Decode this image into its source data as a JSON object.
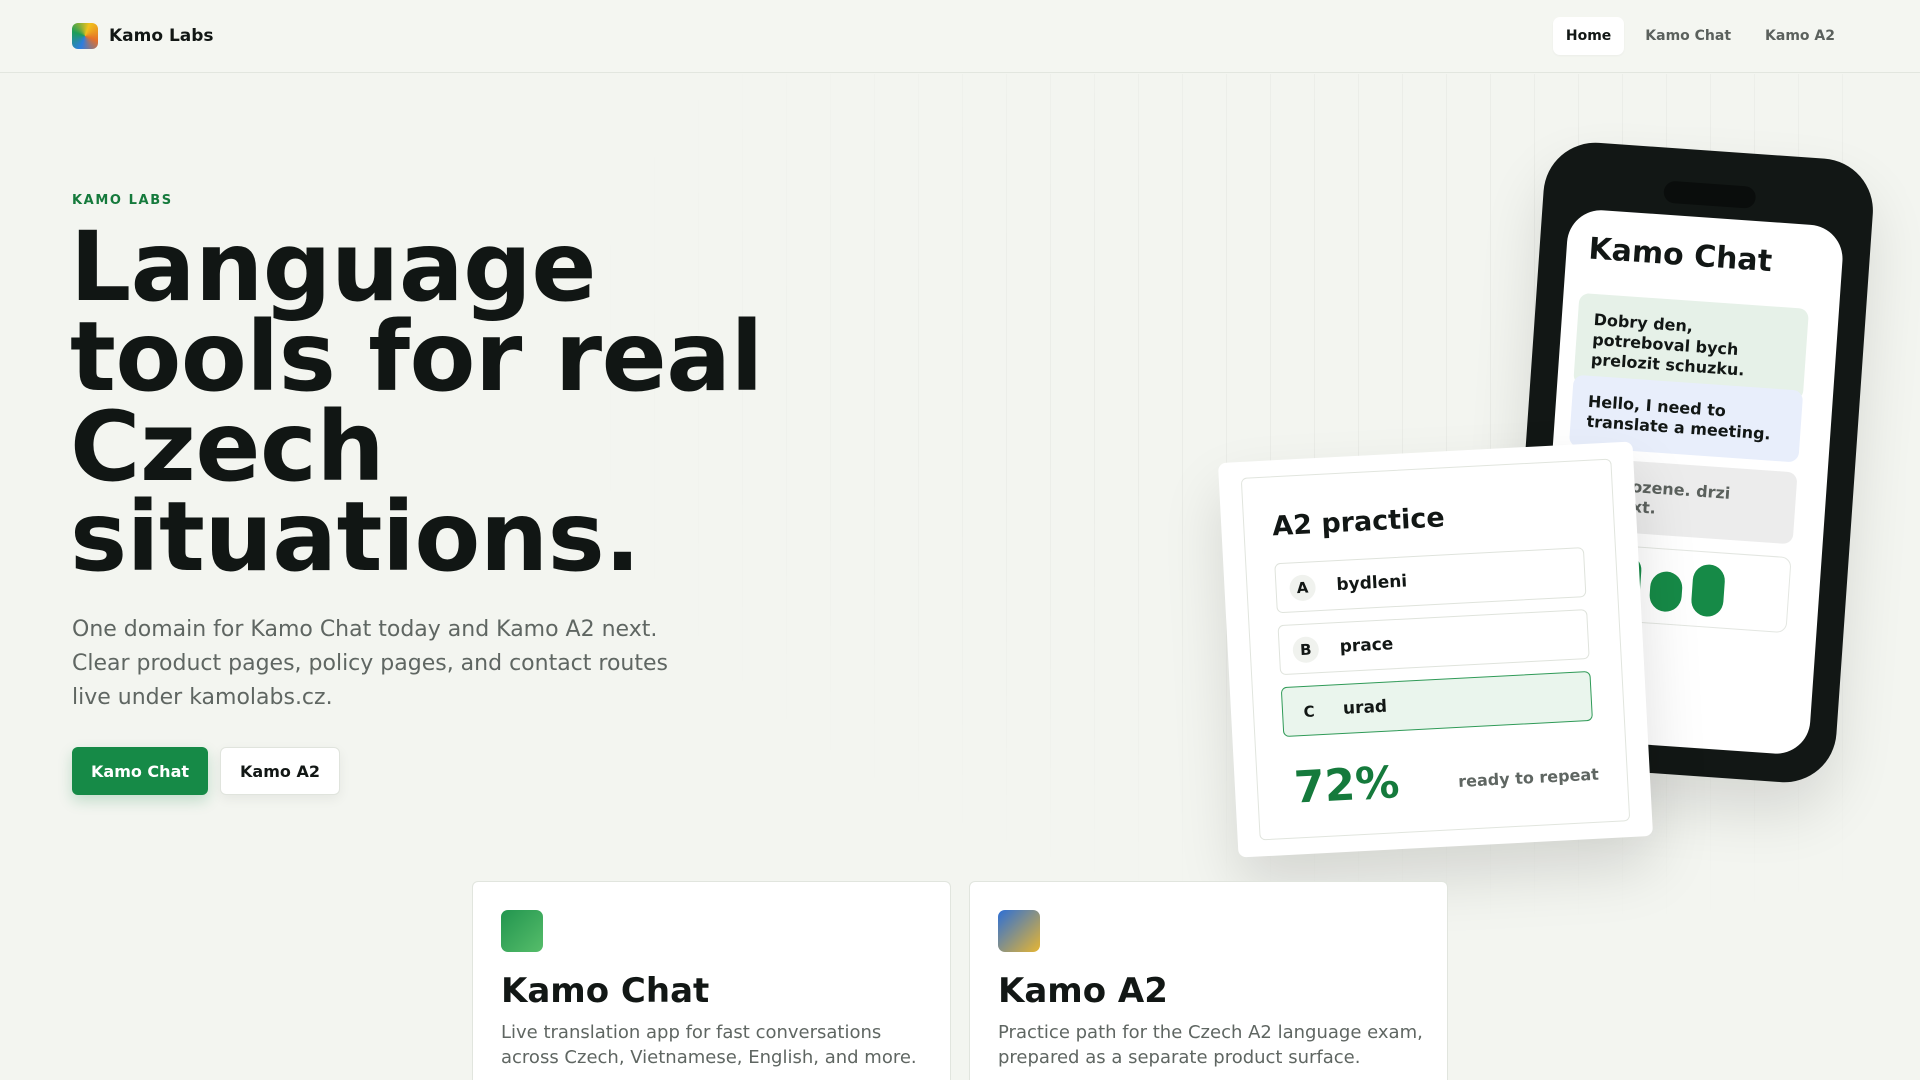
{
  "header": {
    "brand": "Kamo Labs",
    "nav": [
      {
        "label": "Home",
        "active": true
      },
      {
        "label": "Kamo Chat",
        "active": false
      },
      {
        "label": "Kamo A2",
        "active": false
      }
    ]
  },
  "hero": {
    "eyebrow": "KAMO LABS",
    "title": "Language tools for real Czech situations.",
    "subtitle": "One domain for Kamo Chat today and Kamo A2 next. Clear product pages, policy pages, and contact routes live under kamolabs.cz.",
    "primary_button": "Kamo Chat",
    "secondary_button": "Kamo A2"
  },
  "phone": {
    "title": "Kamo Chat",
    "messages": [
      "Dobry den, potreboval bych prelozit schuzku.",
      "Hello, I need to translate a meeting.",
      "e prirozene. drzi kontext."
    ]
  },
  "practice": {
    "title": "A2 practice",
    "options": [
      {
        "letter": "A",
        "word": "bydleni"
      },
      {
        "letter": "B",
        "word": "prace"
      },
      {
        "letter": "C",
        "word": "urad"
      }
    ],
    "score": "72%",
    "score_label": "ready to repeat"
  },
  "products": [
    {
      "name": "Kamo Chat",
      "description": "Live translation app for fast conversations across Czech, Vietnamese, English, and more."
    },
    {
      "name": "Kamo A2",
      "description": "Practice path for the Czech A2 language exam, prepared as a separate product surface."
    }
  ],
  "colors": {
    "accent": "#168a47",
    "background": "#f3f5f0",
    "text": "#121715"
  }
}
